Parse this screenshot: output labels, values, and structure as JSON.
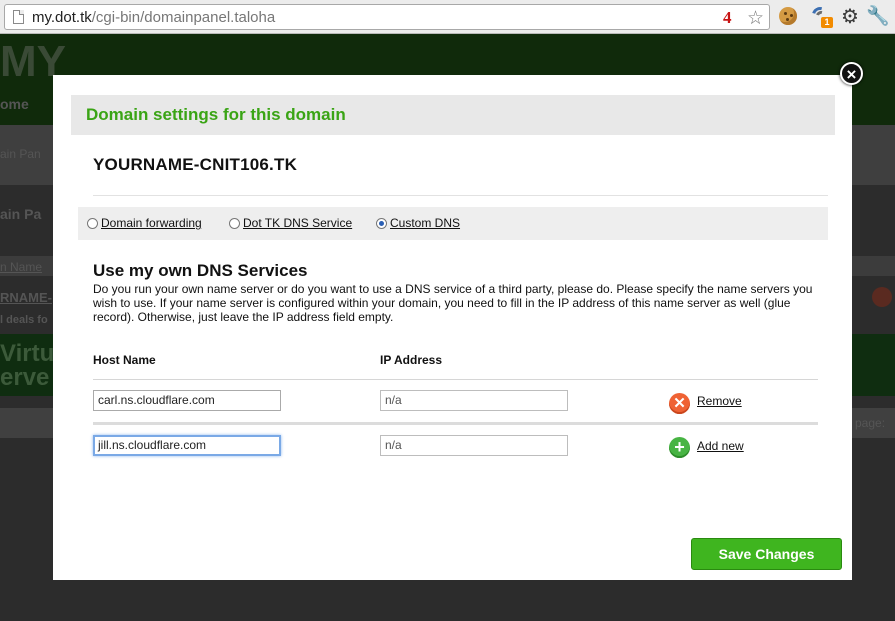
{
  "browser": {
    "url_host": "my.dot.tk",
    "url_path": "/cgi-bin/domainpanel.taloha",
    "extension_badge": "4",
    "extension_count": "1"
  },
  "background_site": {
    "logo": "MY",
    "nav_text": "ome",
    "crumb": "ain Pan",
    "panel_title": "ain Pa",
    "col_label": "n Name",
    "row_name": "RNAME-",
    "row_note": "l deals fo",
    "promo_line1": "Virtua",
    "promo_line2": "erve",
    "paging": "page:"
  },
  "modal": {
    "close_label": "×",
    "title": "Domain settings for this domain",
    "domain": "YOURNAME-CNIT106.TK",
    "radio_options": [
      {
        "label": "Domain forwarding",
        "selected": false
      },
      {
        "label": "Dot TK DNS Service",
        "selected": false
      },
      {
        "label": "Custom DNS",
        "selected": true
      }
    ],
    "section_title": "Use my own DNS Services",
    "description": "Do you run your own name server or do you want to use a DNS service of a third party, please do. Please specify the name servers you wish to use. If your name server is configured within your domain, you need to fill in the IP address of this name server as well (glue record). Otherwise, just leave the IP address field empty.",
    "columns": {
      "host": "Host Name",
      "ip": "IP Address"
    },
    "rows": [
      {
        "host": "carl.ns.cloudflare.com",
        "ip": "n/a",
        "action": "Remove"
      },
      {
        "host": "jill.ns.cloudflare.com",
        "ip": "n/a",
        "action": "Add new"
      }
    ],
    "save_label": "Save Changes"
  },
  "colors": {
    "title_green": "#3aa415",
    "button_green": "#3fb51f",
    "remove_orange": "#ef6234",
    "add_green": "#47b443"
  }
}
